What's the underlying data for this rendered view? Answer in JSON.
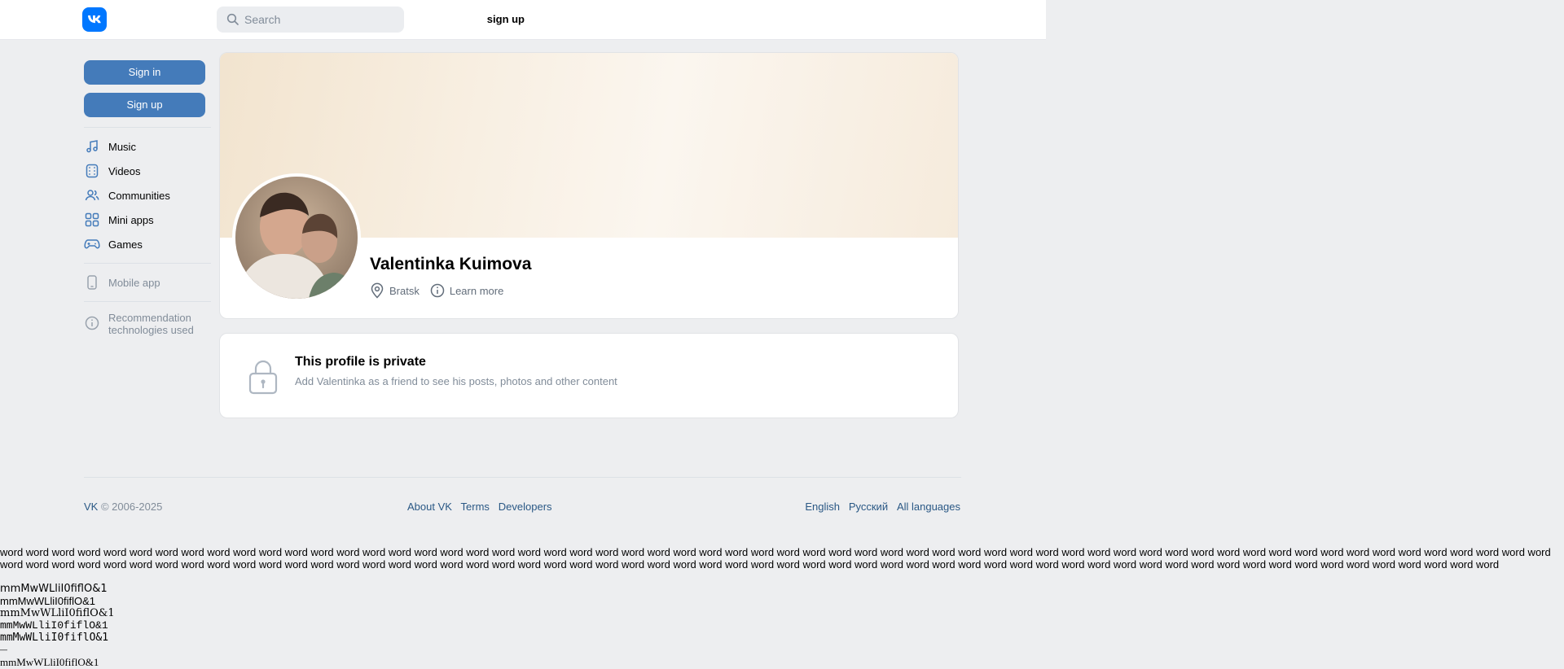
{
  "header": {
    "logo_icon": "vk-logo-icon",
    "search_placeholder": "Search",
    "signup_label": "sign up"
  },
  "sidebar": {
    "signin_button": "Sign in",
    "signup_button": "Sign up",
    "nav": [
      {
        "label": "Music",
        "icon": "music-note-icon"
      },
      {
        "label": "Videos",
        "icon": "film-strip-icon"
      },
      {
        "label": "Communities",
        "icon": "users-icon"
      },
      {
        "label": "Mini apps",
        "icon": "grid-icon"
      },
      {
        "label": "Games",
        "icon": "gamepad-icon"
      }
    ],
    "mobile_app": "Mobile app",
    "recommendation": "Recommendation technologies used"
  },
  "profile": {
    "name": "Valentinka Kuimova",
    "city": "Bratsk",
    "learn_more": "Learn more"
  },
  "private": {
    "title": "This profile is private",
    "subtitle": "Add Valentinka as a friend to see his posts, photos and other content"
  },
  "footer": {
    "brand": "VK",
    "copyright": "© 2006-2025",
    "links": [
      "About VK",
      "Terms",
      "Developers"
    ],
    "languages": [
      "English",
      "Русский",
      "All languages"
    ]
  },
  "filler": {
    "word": "word",
    "font_test": "mmMwWLliI0fiflO&1",
    "dash": "—"
  },
  "colors": {
    "accent": "#447bba",
    "logo": "#0077ff",
    "link": "#2a5885",
    "background": "#edeef0"
  }
}
